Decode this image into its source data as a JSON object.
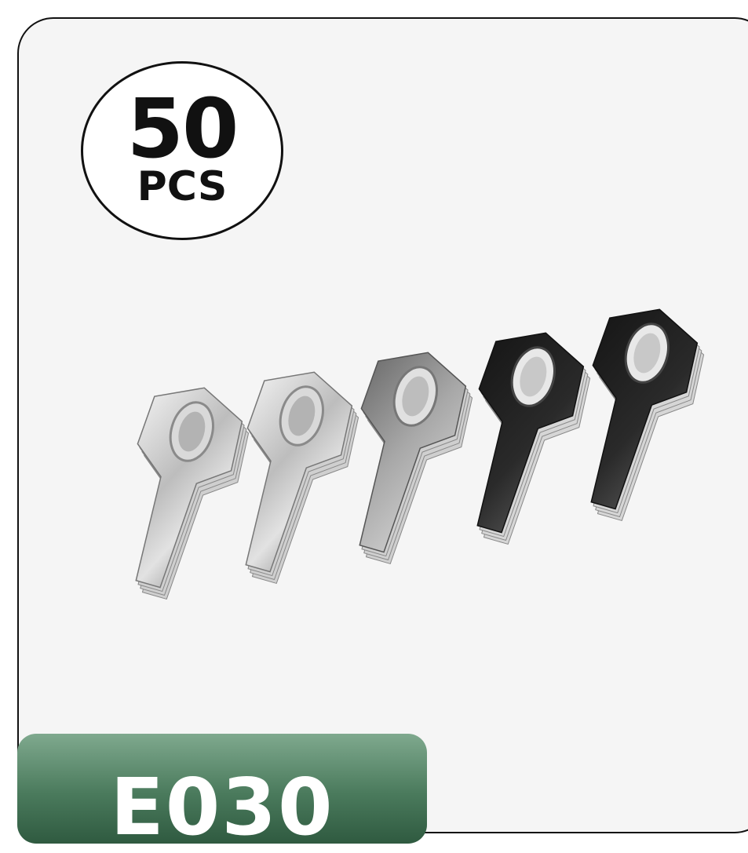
{
  "badge": {
    "quantity": "50",
    "unit": "PCS"
  },
  "product": {
    "icon": "metal-lug-tabs-image",
    "item_count_shown": 5
  },
  "model_tab": {
    "label": "E030",
    "color": "#4a7a5c"
  },
  "colors": {
    "card_border": "#111111",
    "card_background": "#f5f5f5"
  }
}
